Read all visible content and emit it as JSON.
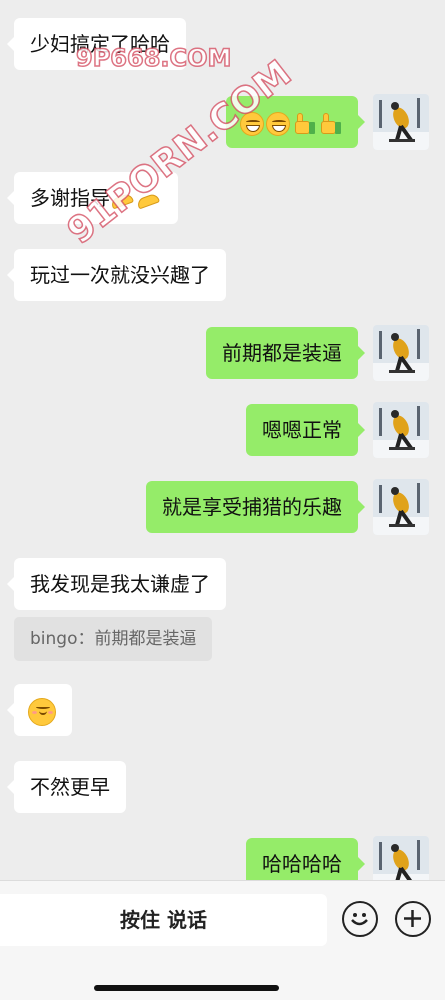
{
  "messages": [
    {
      "side": "left",
      "text": "少妇搞定了哈哈"
    },
    {
      "side": "right",
      "emojis": [
        "grin-emoji",
        "grin-emoji",
        "thumbs-up-emoji",
        "thumbs-up-emoji"
      ]
    },
    {
      "side": "left",
      "text": "多谢指导",
      "emojis": [
        "pray-emoji",
        "pray-emoji"
      ]
    },
    {
      "side": "left",
      "text": "玩过一次就没兴趣了"
    },
    {
      "side": "right",
      "text": "前期都是装逼"
    },
    {
      "side": "right",
      "text": "嗯嗯正常"
    },
    {
      "side": "right",
      "text": "就是享受捕猎的乐趣"
    },
    {
      "side": "left",
      "text": "我发现是我太谦虚了"
    },
    {
      "side": "left",
      "quote": "bingo：前期都是装逼"
    },
    {
      "side": "left",
      "emojis": [
        "blush-emoji"
      ]
    },
    {
      "side": "left",
      "text": "不然更早"
    },
    {
      "side": "right",
      "text": "哈哈哈哈"
    }
  ],
  "watermarks": [
    "9P668.COM",
    "91PORN.COM"
  ],
  "bottom_bar": {
    "voice_button_label": "按住 说话",
    "emoji_button_icon": "smiley-icon",
    "more_button_icon": "plus-icon"
  },
  "colors": {
    "background": "#ededed",
    "self_bubble": "#95ec69",
    "other_bubble": "#ffffff"
  }
}
